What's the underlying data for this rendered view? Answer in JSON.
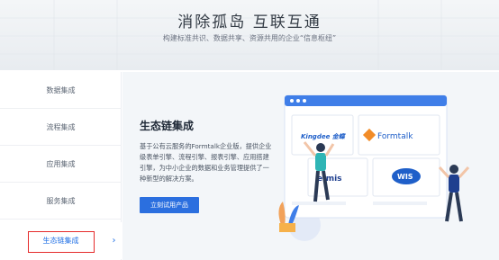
{
  "hero": {
    "title": "消除孤岛 互联互通",
    "subtitle": "构建标准共识、数据共享、资源共用的企业“信息枢纽”"
  },
  "sidebar": {
    "items": [
      {
        "label": "数据集成"
      },
      {
        "label": "流程集成"
      },
      {
        "label": "应用集成"
      },
      {
        "label": "服务集成"
      },
      {
        "label": "生态链集成"
      }
    ],
    "arrow": "›"
  },
  "panel": {
    "title": "生态链集成",
    "description": "基于公有云服务的Formtalk企业版，提供企业级表单引擎、流程引擎、报表引擎、应用搭建引擎，为中小企业的数据和业务管理提供了一种新型的解决方案。",
    "cta_label": "立刻试用产品"
  },
  "illustration": {
    "logos": [
      {
        "text": "Kingdee 金蝶"
      },
      {
        "text": "Formtalk"
      },
      {
        "text": "e:mis"
      },
      {
        "text": "WIS"
      }
    ],
    "accent": "#2b6fdf"
  }
}
